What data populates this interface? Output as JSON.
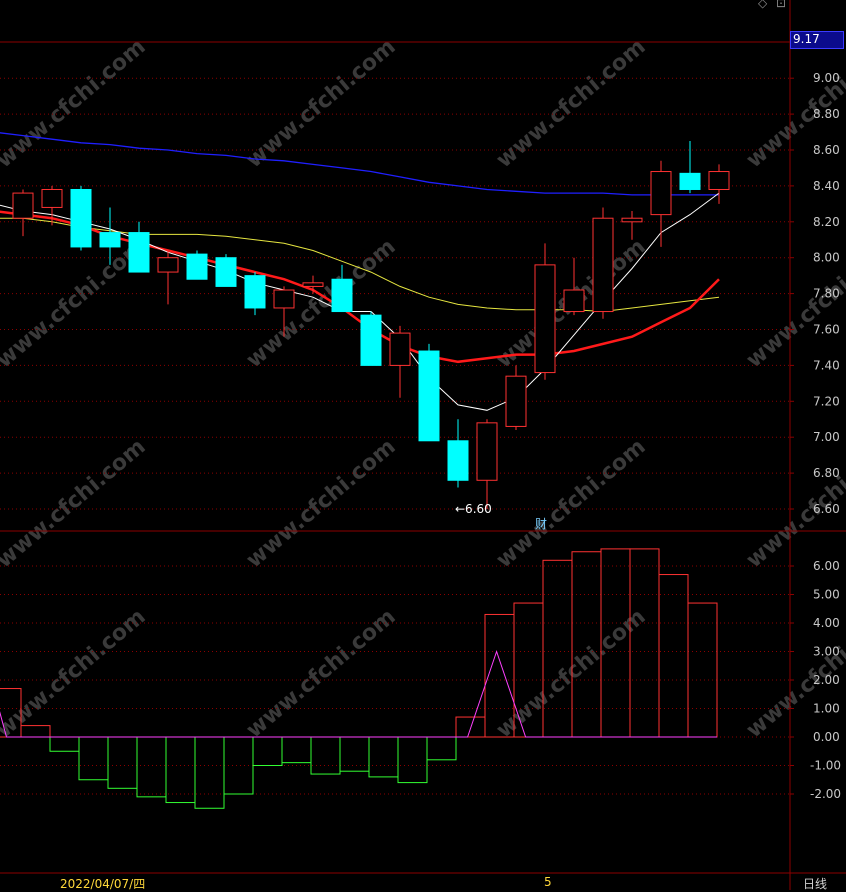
{
  "colors": {
    "up": "#ff3232",
    "down": "#00ffff",
    "ma5": "#ffffff",
    "ma10": "#ff1a1a",
    "ma20": "#e6e640",
    "ma60": "#1f1fff",
    "macd_pos": "#ff3232",
    "macd_neg": "#32ff32",
    "signal": "#ff40ff",
    "grid": "#8b0000"
  },
  "header": {
    "current_price": "9.17",
    "icons": [
      "diamond-icon",
      "maximize-icon"
    ]
  },
  "footer": {
    "date_label": "2022/04/07/四",
    "period_label": "日线",
    "marker_5": "5"
  },
  "annotations": {
    "min_label": "←6.60",
    "finance_marker": "财"
  },
  "chart_data": [
    {
      "type": "candlestick",
      "y_ticks": [
        "9.00",
        "8.80",
        "8.60",
        "8.40",
        "8.20",
        "8.00",
        "7.80",
        "7.60",
        "7.40",
        "7.20",
        "7.00",
        "6.80",
        "6.60"
      ],
      "ylim": [
        6.52,
        9.4
      ],
      "candles": [
        {
          "o": 8.22,
          "c": 8.36,
          "h": 8.38,
          "l": 8.12
        },
        {
          "o": 8.28,
          "c": 8.38,
          "h": 8.4,
          "l": 8.18
        },
        {
          "o": 8.38,
          "c": 8.06,
          "h": 8.4,
          "l": 8.04
        },
        {
          "o": 8.14,
          "c": 8.06,
          "h": 8.28,
          "l": 7.96
        },
        {
          "o": 8.14,
          "c": 7.92,
          "h": 8.2,
          "l": 7.92
        },
        {
          "o": 7.92,
          "c": 8.0,
          "h": 8.04,
          "l": 7.74
        },
        {
          "o": 8.02,
          "c": 7.88,
          "h": 8.04,
          "l": 7.88
        },
        {
          "o": 8.0,
          "c": 7.84,
          "h": 8.02,
          "l": 7.84
        },
        {
          "o": 7.9,
          "c": 7.72,
          "h": 7.92,
          "l": 7.68
        },
        {
          "o": 7.72,
          "c": 7.82,
          "h": 7.84,
          "l": 7.56
        },
        {
          "o": 7.84,
          "c": 7.86,
          "h": 7.9,
          "l": 7.8
        },
        {
          "o": 7.88,
          "c": 7.7,
          "h": 7.96,
          "l": 7.7
        },
        {
          "o": 7.68,
          "c": 7.4,
          "h": 7.7,
          "l": 7.4
        },
        {
          "o": 7.4,
          "c": 7.58,
          "h": 7.62,
          "l": 7.22
        },
        {
          "o": 7.48,
          "c": 6.98,
          "h": 7.52,
          "l": 6.98
        },
        {
          "o": 6.98,
          "c": 6.76,
          "h": 7.1,
          "l": 6.72
        },
        {
          "o": 6.76,
          "c": 7.08,
          "h": 7.1,
          "l": 6.6
        },
        {
          "o": 7.06,
          "c": 7.34,
          "h": 7.4,
          "l": 7.04
        },
        {
          "o": 7.36,
          "c": 7.96,
          "h": 8.08,
          "l": 7.32
        },
        {
          "o": 7.7,
          "c": 7.82,
          "h": 8.0,
          "l": 7.68
        },
        {
          "o": 7.7,
          "c": 8.22,
          "h": 8.28,
          "l": 7.66
        },
        {
          "o": 8.2,
          "c": 8.22,
          "h": 8.26,
          "l": 8.1
        },
        {
          "o": 8.24,
          "c": 8.48,
          "h": 8.54,
          "l": 8.06
        },
        {
          "o": 8.47,
          "c": 8.38,
          "h": 8.65,
          "l": 8.36
        },
        {
          "o": 8.38,
          "c": 8.48,
          "h": 8.52,
          "l": 8.3
        }
      ],
      "ma5": [
        8.3,
        8.26,
        8.24,
        8.2,
        8.16,
        8.1,
        8.03,
        7.98,
        7.93,
        7.86,
        7.82,
        7.78,
        7.7,
        7.7,
        7.55,
        7.33,
        7.18,
        7.15,
        7.22,
        7.38,
        7.57,
        7.76,
        7.94,
        8.14,
        8.24,
        8.36
      ],
      "ma10": [
        8.26,
        8.24,
        8.22,
        8.18,
        8.12,
        8.08,
        8.04,
        8.0,
        7.96,
        7.92,
        7.88,
        7.82,
        7.72,
        7.6,
        7.51,
        7.45,
        7.42,
        7.44,
        7.46,
        7.46,
        7.48,
        7.52,
        7.56,
        7.64,
        7.72,
        7.88
      ],
      "ma20": [
        8.22,
        8.22,
        8.2,
        8.17,
        8.15,
        8.13,
        8.13,
        8.13,
        8.12,
        8.1,
        8.08,
        8.04,
        7.98,
        7.92,
        7.84,
        7.78,
        7.74,
        7.72,
        7.71,
        7.71,
        7.71,
        7.7,
        7.72,
        7.74,
        7.76,
        7.78
      ],
      "ma60": [
        8.7,
        8.68,
        8.66,
        8.64,
        8.63,
        8.61,
        8.6,
        8.58,
        8.57,
        8.55,
        8.54,
        8.52,
        8.5,
        8.48,
        8.45,
        8.42,
        8.4,
        8.38,
        8.37,
        8.36,
        8.36,
        8.36,
        8.35,
        8.35,
        8.35,
        8.35
      ]
    },
    {
      "type": "bar",
      "y_ticks": [
        "6.00",
        "5.00",
        "4.00",
        "3.00",
        "2.00",
        "1.00",
        "0.00",
        "-1.00",
        "-2.00"
      ],
      "ylim": [
        -4.8,
        6.8
      ],
      "values": [
        1.7,
        0.4,
        -0.5,
        -1.5,
        -1.8,
        -2.1,
        -2.3,
        -2.5,
        -2.0,
        -1.0,
        -0.9,
        -1.3,
        -1.2,
        -1.4,
        -1.6,
        -0.8,
        0.7,
        4.3,
        4.7,
        6.2,
        6.5,
        6.6,
        6.6,
        5.7,
        4.7
      ],
      "signal": [
        {
          "x": -0.8,
          "y": 3.0
        },
        {
          "x": 0.0,
          "y": 0.0
        },
        {
          "x": 15.9,
          "y": 0.0
        },
        {
          "x": 16.9,
          "y": 3.0
        },
        {
          "x": 17.9,
          "y": 0.0
        },
        {
          "x": 24.5,
          "y": 0.0
        }
      ]
    }
  ]
}
